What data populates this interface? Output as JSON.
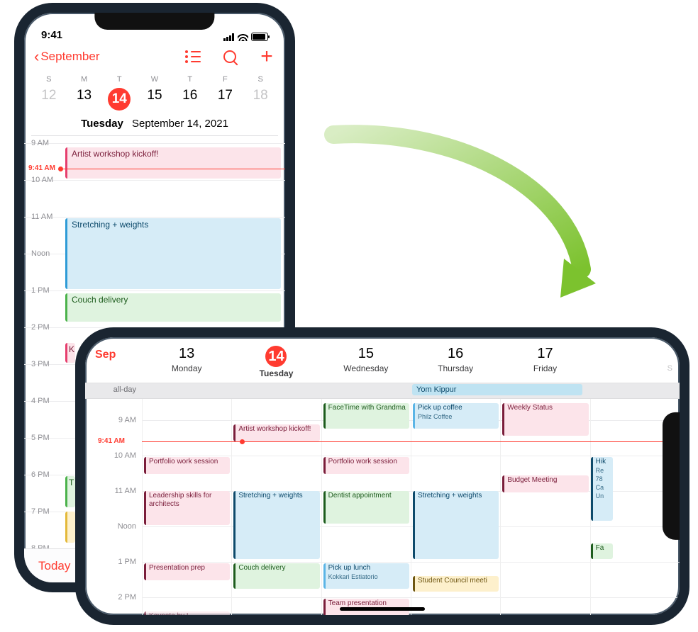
{
  "portrait": {
    "status_time": "9:41",
    "back_label": "September",
    "day_letters": [
      "S",
      "M",
      "T",
      "W",
      "T",
      "F",
      "S"
    ],
    "day_nums": [
      "12",
      "13",
      "14",
      "15",
      "16",
      "17",
      "18"
    ],
    "selected_index": 2,
    "date_dow": "Tuesday",
    "date_full": "September 14, 2021",
    "now_label": "9:41 AM",
    "hours": [
      "9 AM",
      "10 AM",
      "11 AM",
      "Noon",
      "1 PM",
      "2 PM",
      "3 PM",
      "4 PM",
      "5 PM",
      "6 PM",
      "7 PM",
      "8 PM"
    ],
    "today_label": "Today",
    "events": {
      "e1": "Artist workshop kickoff!",
      "e2": "Stretching + weights",
      "e3": "Couch delivery",
      "e4": "K",
      "e5": "T"
    }
  },
  "landscape": {
    "month": "Sep",
    "cols": [
      {
        "num": "13",
        "dow": "Monday"
      },
      {
        "num": "14",
        "dow": "Tuesday"
      },
      {
        "num": "15",
        "dow": "Wednesday"
      },
      {
        "num": "16",
        "dow": "Thursday"
      },
      {
        "num": "17",
        "dow": "Friday"
      }
    ],
    "sat_hint": "S",
    "allday_label": "all-day",
    "allday_event": "Yom Kippur",
    "now_label": "9:41 AM",
    "hours": [
      "9 AM",
      "10 AM",
      "11 AM",
      "Noon",
      "1 PM",
      "2 PM"
    ],
    "events": {
      "mon_1000": "Portfolio work session",
      "mon_1100": "Leadership skills for architects",
      "mon_1300": "Presentation prep",
      "mon_1430": "Keynote by L",
      "tue_0910": "Artist workshop kickoff!",
      "tue_1100": "Stretching + weights",
      "tue_1300": "Couch delivery",
      "wed_0830": "FaceTime with Grandma",
      "wed_1000": "Portfolio work session",
      "wed_1100": "Dentist appointment",
      "wed_1300": "Pick up lunch",
      "wed_1300_sub": "Kokkari Estiatorio",
      "wed_1400": "Team presentation",
      "thu_0830": "Pick up coffee",
      "thu_0830_sub": "Philz Coffee",
      "thu_1100": "Stretching + weights",
      "thu_1330": "Student Council meeti",
      "fri_0830": "Weekly Status",
      "fri_1030": "Budget Meeting",
      "sat_1000": "Hik",
      "sat_1000_sub": "Re\n78\nCa\nUn",
      "sat_1230": "Fa"
    }
  }
}
